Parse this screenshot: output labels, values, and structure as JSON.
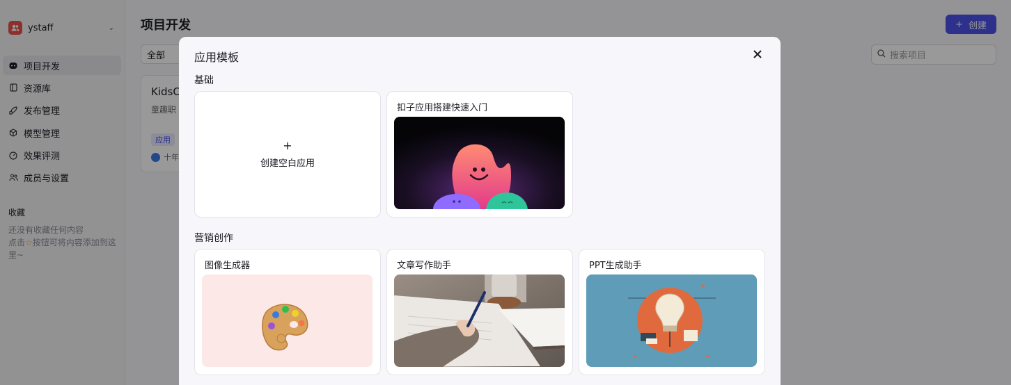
{
  "sidebar": {
    "workspace_name": "ystaff",
    "items": [
      {
        "label": "项目开发",
        "icon": "robot-icon"
      },
      {
        "label": "资源库",
        "icon": "library-icon"
      },
      {
        "label": "发布管理",
        "icon": "rocket-icon"
      },
      {
        "label": "模型管理",
        "icon": "cube-icon"
      },
      {
        "label": "效果评测",
        "icon": "gauge-icon"
      },
      {
        "label": "成员与设置",
        "icon": "people-icon"
      }
    ],
    "favorites_title": "收藏",
    "favorites_empty_line1": "还没有收藏任何内容",
    "favorites_empty_line2": "点击",
    "favorites_empty_line3": "按钮可将内容添加到这里~"
  },
  "main": {
    "title": "项目开发",
    "create_label": "创建",
    "filter_value": "全部",
    "search_placeholder": "搜索项目",
    "project": {
      "name": "KidsC",
      "desc": "童趣职",
      "tag": "应用",
      "owner": "十年"
    }
  },
  "modal": {
    "title": "应用模板",
    "sections": [
      {
        "title": "基础"
      },
      {
        "title": "营销创作"
      }
    ],
    "blank_label": "创建空白应用",
    "blank_plus": "+",
    "templates": [
      {
        "title": "扣子应用搭建快速入门"
      },
      {
        "title": "图像生成器"
      },
      {
        "title": "文章写作助手"
      },
      {
        "title": "PPT生成助手"
      }
    ]
  },
  "colors": {
    "accent": "#4d53e8",
    "workspace_avatar": "#e8504a",
    "palette_bg": "#fde8e8",
    "ppt_bg": "#5e9cb8"
  }
}
